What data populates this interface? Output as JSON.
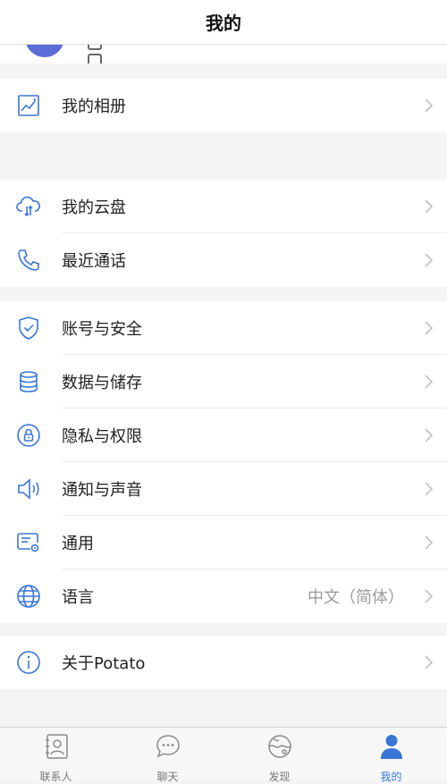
{
  "header": {
    "title": "我的"
  },
  "sections": [
    {
      "items": [
        {
          "label": "我的相册",
          "icon": "photo-album-icon"
        }
      ]
    },
    {
      "items": [
        {
          "label": "我的云盘",
          "icon": "cloud-drive-icon"
        },
        {
          "label": "最近通话",
          "icon": "phone-icon"
        }
      ]
    },
    {
      "items": [
        {
          "label": "账号与安全",
          "icon": "shield-icon"
        },
        {
          "label": "数据与储存",
          "icon": "database-icon"
        },
        {
          "label": "隐私与权限",
          "icon": "lock-icon"
        },
        {
          "label": "通知与声音",
          "icon": "speaker-icon"
        },
        {
          "label": "通用",
          "icon": "settings-card-icon"
        },
        {
          "label": "语言",
          "icon": "globe-icon",
          "value": "中文（简体）"
        }
      ]
    },
    {
      "items": [
        {
          "label": "关于Potato",
          "icon": "info-icon"
        }
      ]
    }
  ],
  "tabs": [
    {
      "label": "联系人",
      "icon": "contacts-icon",
      "active": false
    },
    {
      "label": "聊天",
      "icon": "chat-icon",
      "active": false
    },
    {
      "label": "发现",
      "icon": "discover-icon",
      "active": false
    },
    {
      "label": "我的",
      "icon": "person-icon",
      "active": true
    }
  ],
  "colors": {
    "accent": "#3a76d6",
    "background": "#f4f4f6",
    "text": "#222222",
    "secondary": "#9b9b9b"
  }
}
